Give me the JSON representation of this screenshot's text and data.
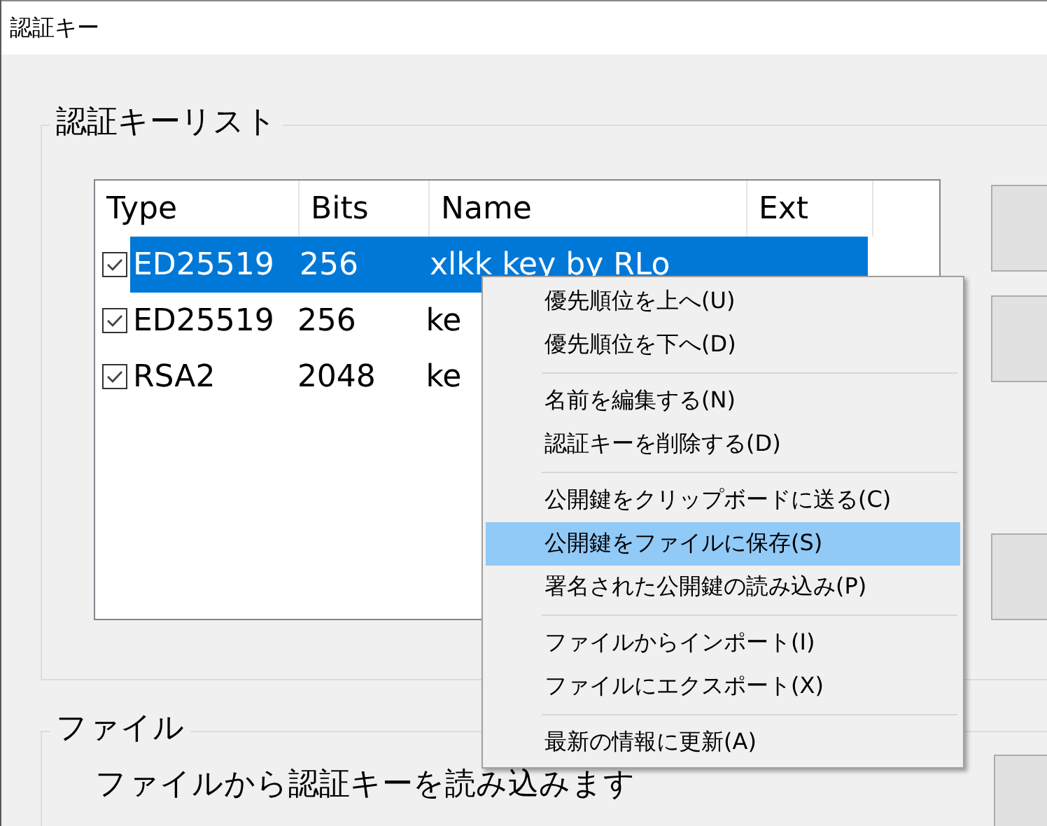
{
  "window": {
    "title": "認証キー"
  },
  "key_list": {
    "title": "認証キーリスト",
    "columns": [
      "Type",
      "Bits",
      "Name",
      "Ext"
    ],
    "rows": [
      {
        "checked": true,
        "selected": true,
        "cells": [
          "ED25519",
          "256",
          "xlkk key by RLo",
          ""
        ]
      },
      {
        "checked": true,
        "selected": false,
        "cells": [
          "ED25519",
          "256",
          "ke",
          ""
        ]
      },
      {
        "checked": true,
        "selected": false,
        "cells": [
          "RSA2",
          "2048",
          "ke",
          ""
        ]
      }
    ]
  },
  "context_menu": [
    {
      "kind": "item",
      "label": "優先順位を上へ(U)",
      "selected": false
    },
    {
      "kind": "item",
      "label": "優先順位を下へ(D)",
      "selected": false
    },
    {
      "kind": "separator"
    },
    {
      "kind": "item",
      "label": "名前を編集する(N)",
      "selected": false
    },
    {
      "kind": "item",
      "label": "認証キーを削除する(D)",
      "selected": false
    },
    {
      "kind": "separator"
    },
    {
      "kind": "item",
      "label": "公開鍵をクリップボードに送る(C)",
      "selected": false
    },
    {
      "kind": "item",
      "label": "公開鍵をファイルに保存(S)",
      "selected": true
    },
    {
      "kind": "item",
      "label": "署名された公開鍵の読み込み(P)",
      "selected": false
    },
    {
      "kind": "separator"
    },
    {
      "kind": "item",
      "label": "ファイルからインポート(I)",
      "selected": false
    },
    {
      "kind": "item",
      "label": "ファイルにエクスポート(X)",
      "selected": false
    },
    {
      "kind": "separator"
    },
    {
      "kind": "item",
      "label": "最新の情報に更新(A)",
      "selected": false
    }
  ],
  "file_group": {
    "title": "ファイル",
    "description": "ファイルから認証キーを読み込みます"
  }
}
